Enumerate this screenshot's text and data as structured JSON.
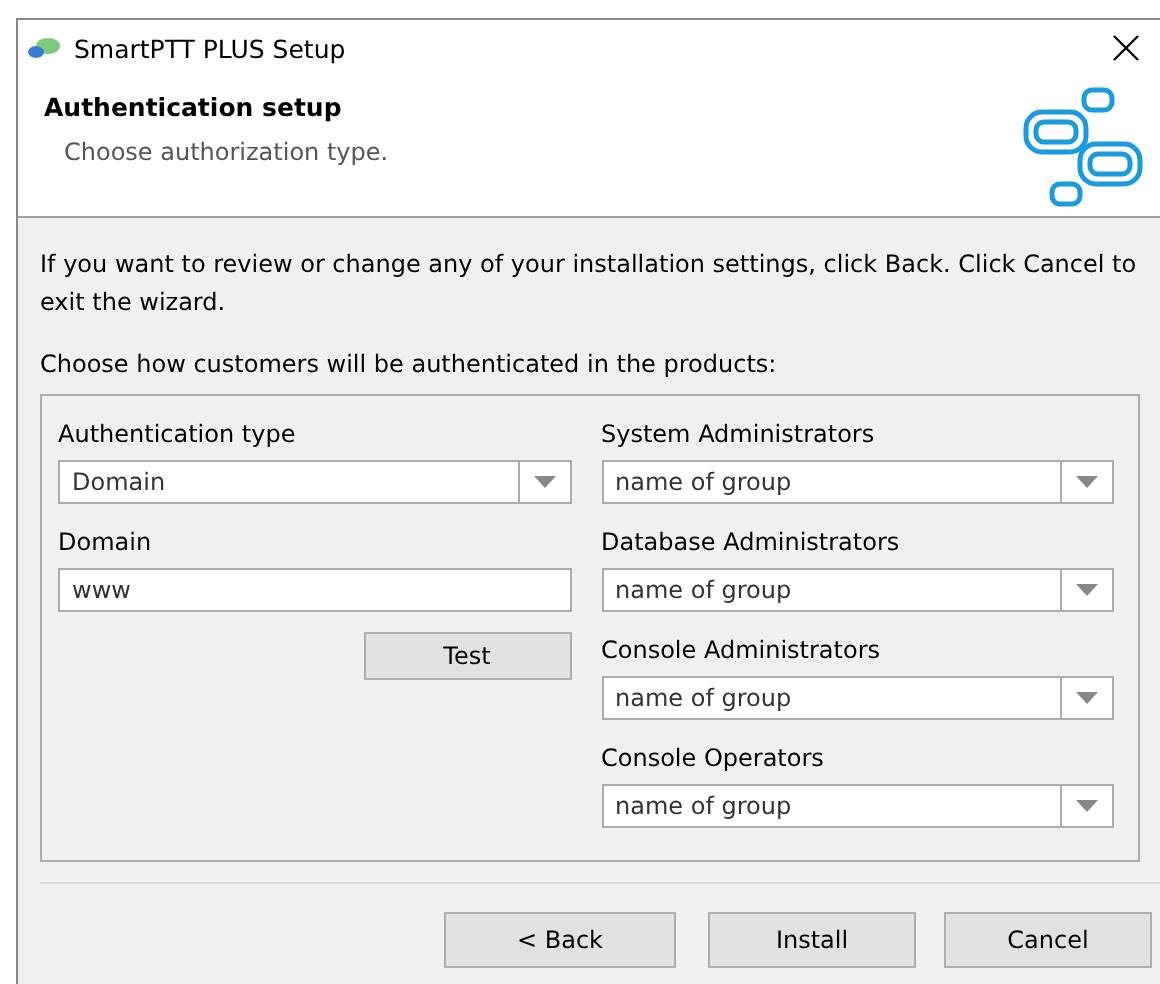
{
  "window": {
    "title": "SmartPTT PLUS Setup"
  },
  "header": {
    "title": "Authentication setup",
    "subtitle": "Choose authorization type."
  },
  "intro": "If you want to review or change any of your installation settings, click Back. Click Cancel to exit the wizard.",
  "prompt": "Choose how customers will be authenticated in the products:",
  "left_fields": [
    {
      "kind": "dropdown",
      "label": "Authentication type",
      "value": "Domain"
    },
    {
      "kind": "text",
      "label": "Domain",
      "value": "www"
    }
  ],
  "test_button": "Test",
  "right_fields": [
    {
      "kind": "dropdown",
      "label": "System Administrators",
      "value": "name of group"
    },
    {
      "kind": "dropdown",
      "label": "Database Administrators",
      "value": "name of group"
    },
    {
      "kind": "dropdown",
      "label": "Console Administrators",
      "value": "name of group"
    },
    {
      "kind": "dropdown",
      "label": "Console Operators",
      "value": "name of group"
    }
  ],
  "buttons": [
    "< Back",
    "Install",
    "Cancel"
  ]
}
